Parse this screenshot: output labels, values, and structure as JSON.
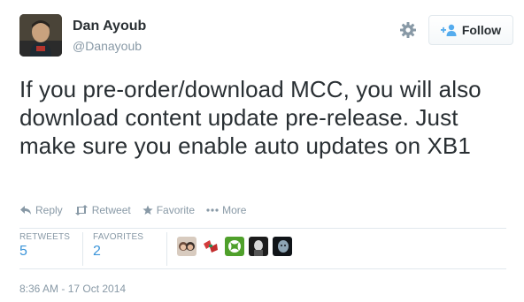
{
  "user": {
    "name": "Dan Ayoub",
    "handle": "@Danayoub"
  },
  "follow_button": {
    "label": "Follow",
    "icon": "add-user-icon"
  },
  "tweet": {
    "text": "If you pre-order/download MCC, you will also download content update pre-release. Just make sure you enable auto updates on XB1"
  },
  "actions": [
    {
      "label": "Reply",
      "icon": "reply-icon"
    },
    {
      "label": "Retweet",
      "icon": "retweet-icon"
    },
    {
      "label": "Favorite",
      "icon": "star-icon"
    },
    {
      "label": "More",
      "icon": "more-dots-icon"
    }
  ],
  "stats": {
    "retweets_label": "RETWEETS",
    "retweets_count": "5",
    "favorites_label": "FAVORITES",
    "favorites_count": "2"
  },
  "timestamp": "8:36 AM - 17 Oct 2014",
  "colors": {
    "accent": "#3b94d9",
    "muted": "#8899a6",
    "text": "#292f33",
    "border": "#e1e8ed"
  }
}
